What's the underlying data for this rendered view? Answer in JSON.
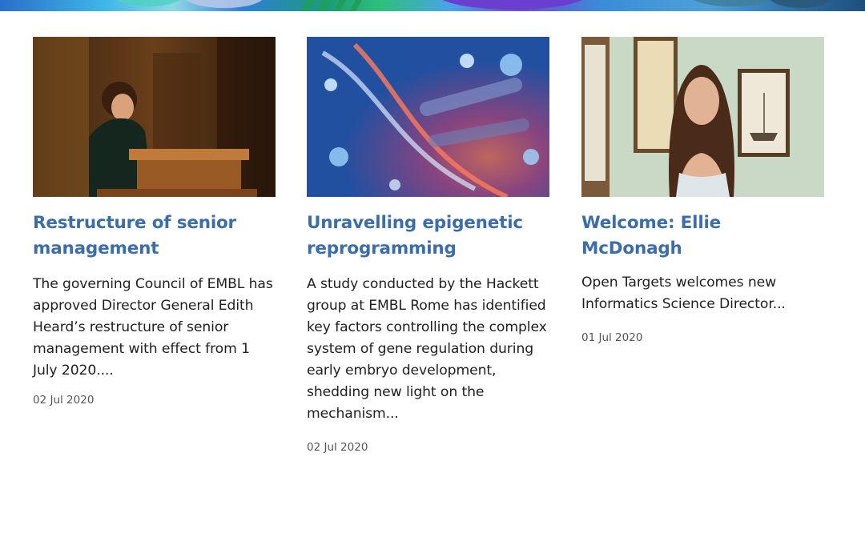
{
  "banner": {
    "colors": [
      "#2a6fc9",
      "#3fb5e8",
      "#1b9c7a",
      "#6a4fd0",
      "#1e4f7a"
    ]
  },
  "news": [
    {
      "title": "Restructure of senior management",
      "summary": "The governing Council of EMBL has approved Director General Edith Heard’s restructure of senior management with effect from 1 July 2020....",
      "date": "02 Jul 2020",
      "image_subject": "speaker-at-podium-photo"
    },
    {
      "title": "Unravelling epigenetic reprogramming",
      "summary": "A study conducted by the Hackett group at EMBL Rome has identified key factors controlling the complex system of gene regulation during early embryo development, shedding new light on the mechanism...",
      "date": "02 Jul 2020",
      "image_subject": "dna-molecules-illustration"
    },
    {
      "title": "Welcome: Ellie McDonagh",
      "summary": "Open Targets welcomes new Informatics Science Director...",
      "date": "01 Jul 2020",
      "image_subject": "portrait-photo"
    }
  ],
  "colors": {
    "link": "#3b6ea8",
    "text": "#1f1f1f",
    "date": "#555555"
  }
}
